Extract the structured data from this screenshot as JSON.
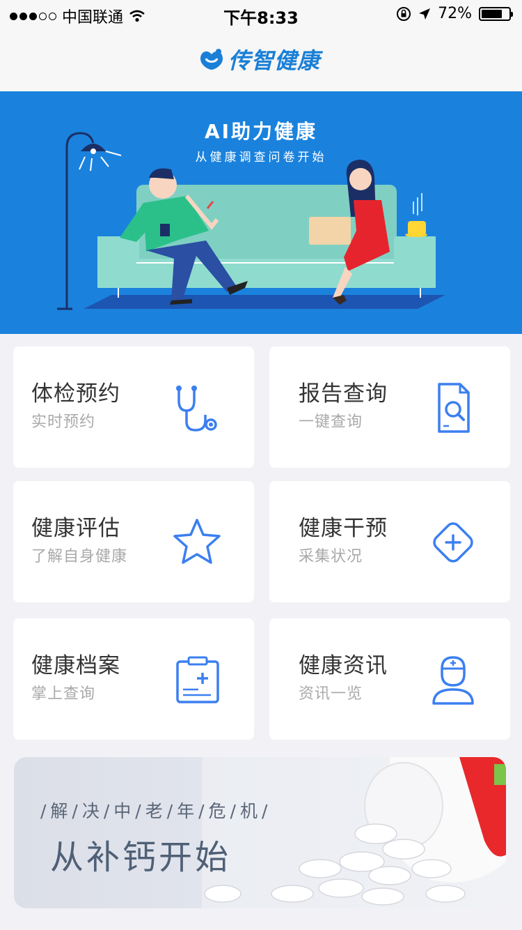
{
  "status_bar": {
    "carrier": "中国联通",
    "time": "下午8:33",
    "battery": "72%",
    "battery_level": 0.72
  },
  "nav": {
    "logo_text": "传智健康"
  },
  "banner": {
    "title": "AI助力健康",
    "subtitle": "从健康调查问卷开始"
  },
  "cards": [
    {
      "title": "体检预约",
      "subtitle": "实时预约",
      "icon": "stethoscope-icon"
    },
    {
      "title": "报告查询",
      "subtitle": "一键查询",
      "icon": "report-search-icon"
    },
    {
      "title": "健康评估",
      "subtitle": "了解自身健康",
      "icon": "star-icon"
    },
    {
      "title": "健康干预",
      "subtitle": "采集状况",
      "icon": "medical-plus-icon"
    },
    {
      "title": "健康档案",
      "subtitle": "掌上查询",
      "icon": "medical-record-icon"
    },
    {
      "title": "健康资讯",
      "subtitle": "资讯一览",
      "icon": "doctor-icon"
    }
  ],
  "promo": {
    "subtitle": "/解/决/中/老/年/危/机/",
    "title": "从补钙开始"
  },
  "colors": {
    "brand_blue": "#1a82dd",
    "icon_blue": "#3b7ff0",
    "background": "#f2f2f6"
  }
}
